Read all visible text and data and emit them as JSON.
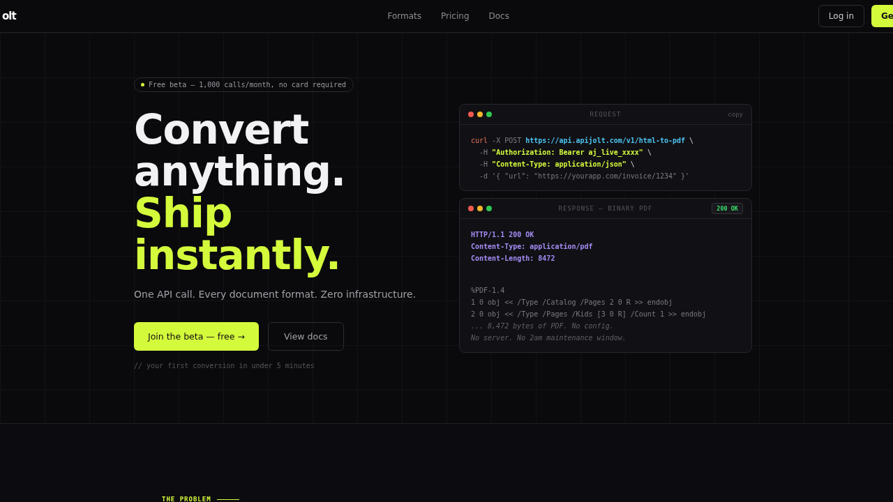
{
  "nav": {
    "logo": "olt",
    "links": [
      "Formats",
      "Pricing",
      "Docs"
    ],
    "login": "Log in",
    "cta": "Ge"
  },
  "hero": {
    "badge": "Free beta — 1,000 calls/month, no card required",
    "headline": [
      {
        "text": "Convert",
        "accent": false
      },
      {
        "text": "anything.",
        "accent": false
      },
      {
        "text": "Ship",
        "accent": true
      },
      {
        "text": "instantly.",
        "accent": true
      }
    ],
    "subtitle": "One API call. Every document format. Zero infrastructure.",
    "primary_button": "Join the beta — free →",
    "secondary_button": "View docs",
    "note": "// your first conversion in under 5 minutes"
  },
  "request": {
    "title": "REQUEST",
    "action": "copy",
    "lines": [
      [
        {
          "kind": "command",
          "text": "curl"
        },
        {
          "kind": "flag",
          "text": " -X POST "
        },
        {
          "kind": "url",
          "text": "https://api.apijolt.com/v1/html-to-pdf"
        },
        {
          "kind": "plain",
          "text": " \\"
        }
      ],
      [
        {
          "kind": "flag",
          "text": "  -H "
        },
        {
          "kind": "string",
          "text": "\"Authorization: Bearer aj_live_xxxx\""
        },
        {
          "kind": "plain",
          "text": " \\"
        }
      ],
      [
        {
          "kind": "flag",
          "text": "  -H "
        },
        {
          "kind": "string",
          "text": "\"Content-Type: application/json\""
        },
        {
          "kind": "plain",
          "text": " \\"
        }
      ],
      [
        {
          "kind": "flag",
          "text": "  -d '{ \"url\": \"https://yourapp.com/invoice/1234\" }'"
        }
      ]
    ]
  },
  "response": {
    "title": "RESPONSE — BINARY PDF",
    "status": "200 OK",
    "headers": [
      [
        {
          "kind": "header",
          "text": "HTTP/1.1 200 OK"
        }
      ],
      [
        {
          "kind": "header",
          "text": "Content-Type: application/pdf"
        }
      ],
      [
        {
          "kind": "header",
          "text": "Content-Length: 8472"
        }
      ]
    ],
    "body": [
      [
        {
          "kind": "flag",
          "text": "%PDF-1.4"
        }
      ],
      [
        {
          "kind": "flag",
          "text": "1 0 obj << /Type /Catalog /Pages 2 0 R >> endobj"
        }
      ],
      [
        {
          "kind": "flag",
          "text": "2 0 obj << /Type /Pages /Kids [3 0 R] /Count 1 >> endobj"
        }
      ],
      [
        {
          "kind": "comment",
          "text": "... 8,472 bytes of PDF. No config."
        }
      ],
      [
        {
          "kind": "comment",
          "text": "No server. No 2am maintenance window."
        }
      ]
    ]
  },
  "section": {
    "eyebrow": "THE PROBLEM"
  }
}
